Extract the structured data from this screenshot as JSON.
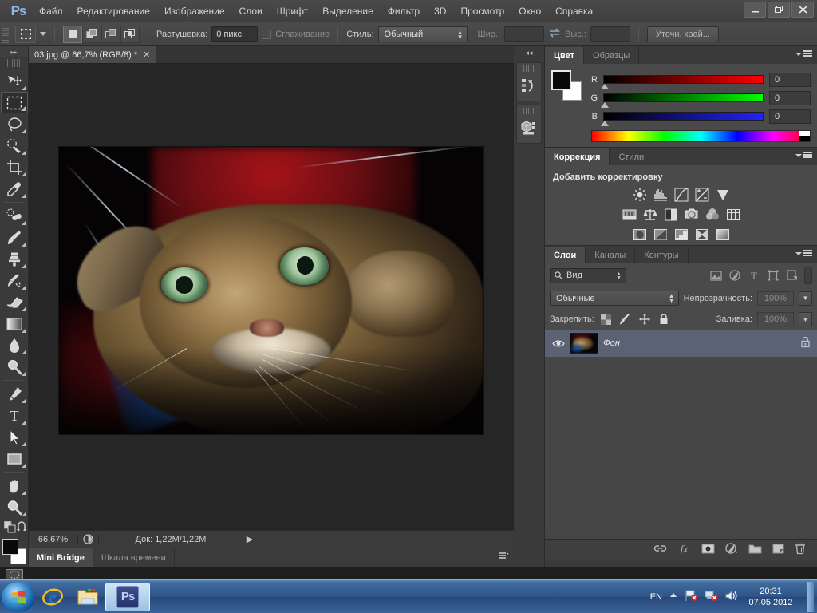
{
  "app": {
    "name": "Adobe Photoshop",
    "logo_text": "Ps"
  },
  "menubar": {
    "items": [
      {
        "label": "Файл"
      },
      {
        "label": "Редактирование"
      },
      {
        "label": "Изображение"
      },
      {
        "label": "Слои"
      },
      {
        "label": "Шрифт"
      },
      {
        "label": "Выделение"
      },
      {
        "label": "Фильтр"
      },
      {
        "label": "3D"
      },
      {
        "label": "Просмотр"
      },
      {
        "label": "Окно"
      },
      {
        "label": "Справка"
      }
    ],
    "window_controls": {
      "minimize": "—",
      "restore": "❐",
      "close": "✕"
    }
  },
  "optionsbar": {
    "tool_preset_icon": "rectangular-marquee-icon",
    "selection_modes": [
      "new-selection",
      "add-to-selection",
      "subtract-from-selection",
      "intersect-selection"
    ],
    "feather_label": "Растушевка:",
    "feather_value": "0 пикс.",
    "antialias_label": "Сглаживание",
    "antialias_checked": false,
    "style_label": "Стиль:",
    "style_value": "Обычный",
    "width_label": "Шир.:",
    "width_value": "",
    "height_label": "Выс.:",
    "height_value": "",
    "swap_icon": "swap-arrows-icon",
    "refine_edge_label": "Уточн. край..."
  },
  "toolbar": {
    "collapse_label": "▸▸",
    "tools": [
      {
        "name": "move-tool",
        "active": false
      },
      {
        "name": "rectangular-marquee-tool",
        "active": true
      },
      {
        "name": "lasso-tool",
        "active": false
      },
      {
        "name": "quick-selection-tool",
        "active": false
      },
      {
        "name": "crop-tool",
        "active": false
      },
      {
        "name": "eyedropper-tool",
        "active": false
      },
      {
        "name": "healing-brush-tool",
        "active": false
      },
      {
        "name": "brush-tool",
        "active": false
      },
      {
        "name": "clone-stamp-tool",
        "active": false
      },
      {
        "name": "history-brush-tool",
        "active": false
      },
      {
        "name": "eraser-tool",
        "active": false
      },
      {
        "name": "gradient-tool",
        "active": false
      },
      {
        "name": "blur-tool",
        "active": false
      },
      {
        "name": "dodge-tool",
        "active": false
      },
      {
        "name": "pen-tool",
        "active": false
      },
      {
        "name": "type-tool",
        "active": false
      },
      {
        "name": "path-selection-tool",
        "active": false
      },
      {
        "name": "rectangle-tool",
        "active": false
      },
      {
        "name": "hand-tool",
        "active": false
      },
      {
        "name": "zoom-tool",
        "active": false
      }
    ],
    "foreground_color": "#000000",
    "background_color": "#ffffff"
  },
  "document": {
    "tab_title": "03.jpg @ 66,7% (RGB/8) *",
    "close_glyph": "✕",
    "statusbar": {
      "zoom": "66,67%",
      "doc_info": "Док: 1,22M/1,22M",
      "arrow": "▶"
    },
    "bottom_tabs": [
      {
        "label": "Mini Bridge",
        "active": true
      },
      {
        "label": "Шкала времени",
        "active": false
      }
    ]
  },
  "dockstrip": {
    "collapse_label": "◂◂",
    "icons": [
      {
        "name": "history-panel-icon"
      },
      {
        "name": "3d-panel-icon"
      }
    ]
  },
  "color_panel": {
    "tabs": [
      {
        "label": "Цвет",
        "active": true
      },
      {
        "label": "Образцы",
        "active": false
      }
    ],
    "channels": [
      {
        "label": "R",
        "value": "0",
        "accent": "#ff0000"
      },
      {
        "label": "G",
        "value": "0",
        "accent": "#00ff00"
      },
      {
        "label": "B",
        "value": "0",
        "accent": "#2222ff"
      }
    ],
    "foreground": "#000000",
    "background": "#ffffff"
  },
  "adjustments_panel": {
    "tabs": [
      {
        "label": "Коррекция",
        "active": true
      },
      {
        "label": "Стили",
        "active": false
      }
    ],
    "title": "Добавить корректировку",
    "rows": [
      [
        {
          "name": "brightness-contrast-icon"
        },
        {
          "name": "levels-icon"
        },
        {
          "name": "curves-icon"
        },
        {
          "name": "exposure-icon"
        },
        {
          "name": "vibrance-icon"
        }
      ],
      [
        {
          "name": "hue-saturation-icon"
        },
        {
          "name": "color-balance-icon"
        },
        {
          "name": "black-white-icon"
        },
        {
          "name": "photo-filter-icon"
        },
        {
          "name": "channel-mixer-icon"
        },
        {
          "name": "color-lookup-icon"
        }
      ],
      [
        {
          "name": "invert-icon"
        },
        {
          "name": "posterize-icon"
        },
        {
          "name": "threshold-icon"
        },
        {
          "name": "gradient-map-icon"
        },
        {
          "name": "selective-color-icon"
        }
      ]
    ]
  },
  "layers_panel": {
    "tabs": [
      {
        "label": "Слои",
        "active": true
      },
      {
        "label": "Каналы",
        "active": false
      },
      {
        "label": "Контуры",
        "active": false
      }
    ],
    "filter": {
      "search_icon": "search-icon",
      "value": "Вид",
      "type_icons": [
        {
          "name": "filter-pixel-icon"
        },
        {
          "name": "filter-adjustment-icon"
        },
        {
          "name": "filter-type-icon"
        },
        {
          "name": "filter-shape-icon"
        },
        {
          "name": "filter-smartobject-icon"
        }
      ],
      "toggle_icon": "filter-toggle-icon"
    },
    "blend_mode": "Обычные",
    "opacity_label": "Непрозрачность:",
    "opacity_value": "100%",
    "lock_label": "Закрепить:",
    "lock_icons": [
      {
        "name": "lock-transparency-icon"
      },
      {
        "name": "lock-image-icon"
      },
      {
        "name": "lock-position-icon"
      },
      {
        "name": "lock-all-icon"
      }
    ],
    "fill_label": "Заливка:",
    "fill_value": "100%",
    "layers": [
      {
        "name": "Фон",
        "visible": true,
        "locked": true,
        "visibility_icon": "eye-icon",
        "lock_icon": "lock-icon"
      }
    ],
    "bottom_buttons": [
      {
        "name": "link-layers-icon",
        "glyph": "🔗"
      },
      {
        "name": "layer-style-icon",
        "glyph": "fx"
      },
      {
        "name": "layer-mask-icon",
        "glyph": "◉"
      },
      {
        "name": "new-fill-adjustment-icon",
        "glyph": "◐"
      },
      {
        "name": "new-group-icon",
        "glyph": "🗀"
      },
      {
        "name": "new-layer-icon",
        "glyph": "❐"
      },
      {
        "name": "delete-layer-icon",
        "glyph": "🗑"
      }
    ]
  },
  "taskbar": {
    "start_button": "start-orb-icon",
    "pinned": [
      {
        "name": "internet-explorer-icon"
      },
      {
        "name": "windows-explorer-icon"
      },
      {
        "name": "photoshop-taskbar-button",
        "label": "Ps",
        "active": true
      }
    ],
    "tray": {
      "language": "EN",
      "expand_icon": "show-hidden-icons-icon",
      "icons": [
        {
          "name": "action-center-flag-icon"
        },
        {
          "name": "network-icon"
        },
        {
          "name": "volume-icon"
        }
      ],
      "time": "20:31",
      "date": "07.05.2012"
    }
  },
  "colors": {
    "panel_bg": "#4a4a4a",
    "chrome_bg": "#3a3a3a",
    "canvas_bg": "#262626",
    "selection_blue": "#5a6274",
    "accent_text": "#ffffff",
    "taskbar_blue": "#2f5486"
  }
}
